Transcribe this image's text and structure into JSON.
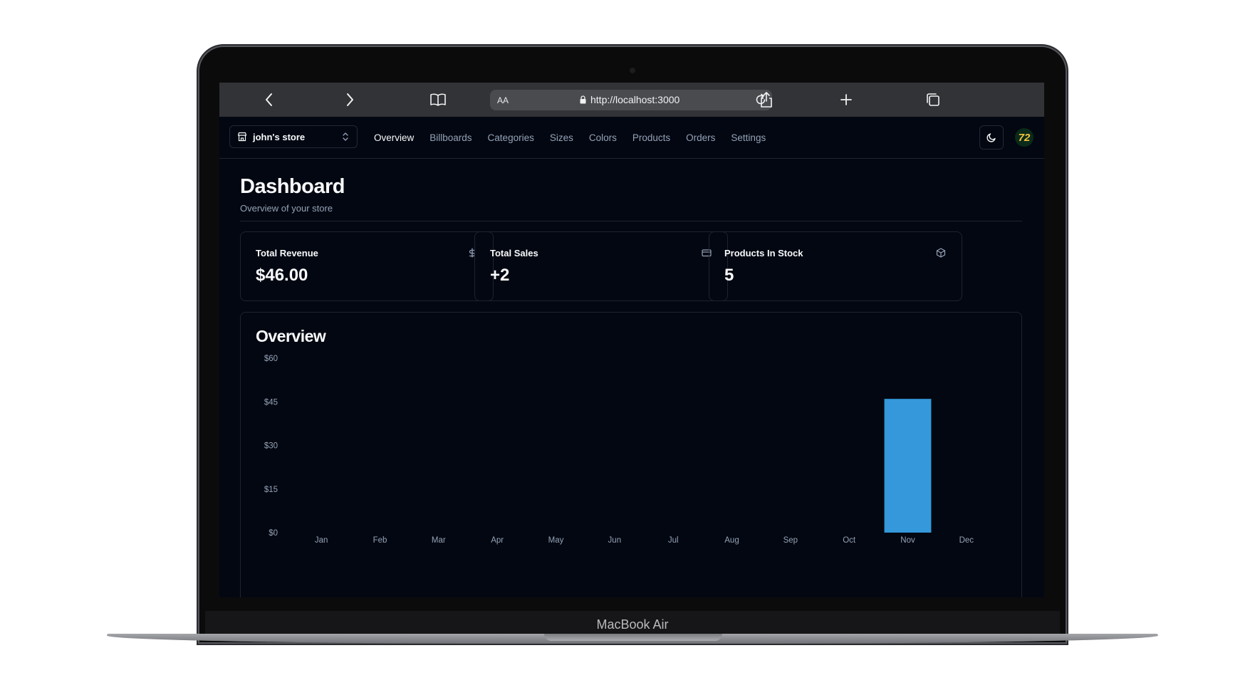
{
  "device": {
    "label": "MacBook Air"
  },
  "browser": {
    "aa_label": "AA",
    "url": "http://localhost:3000"
  },
  "nav": {
    "store_name": "john's store",
    "links": [
      "Overview",
      "Billboards",
      "Categories",
      "Sizes",
      "Colors",
      "Products",
      "Orders",
      "Settings"
    ],
    "active": "Overview",
    "avatar_text": "72"
  },
  "page": {
    "title": "Dashboard",
    "subtitle": "Overview of your store"
  },
  "stats": [
    {
      "label": "Total Revenue",
      "value": "$46.00",
      "icon": "dollar-icon"
    },
    {
      "label": "Total Sales",
      "value": "+2",
      "icon": "credit-card-icon"
    },
    {
      "label": "Products In Stock",
      "value": "5",
      "icon": "package-icon"
    }
  ],
  "overview": {
    "title": "Overview"
  },
  "chart_data": {
    "type": "bar",
    "categories": [
      "Jan",
      "Feb",
      "Mar",
      "Apr",
      "May",
      "Jun",
      "Jul",
      "Aug",
      "Sep",
      "Oct",
      "Nov",
      "Dec"
    ],
    "values": [
      0,
      0,
      0,
      0,
      0,
      0,
      0,
      0,
      0,
      0,
      46,
      0
    ],
    "yticks": [
      "$0",
      "$15",
      "$30",
      "$45",
      "$60"
    ],
    "ylim": [
      0,
      60
    ],
    "bar_color": "#3498db",
    "grid": false
  },
  "colors": {
    "background": "#030711",
    "accent_bar": "#3498db",
    "muted_text": "#94a3b8"
  }
}
